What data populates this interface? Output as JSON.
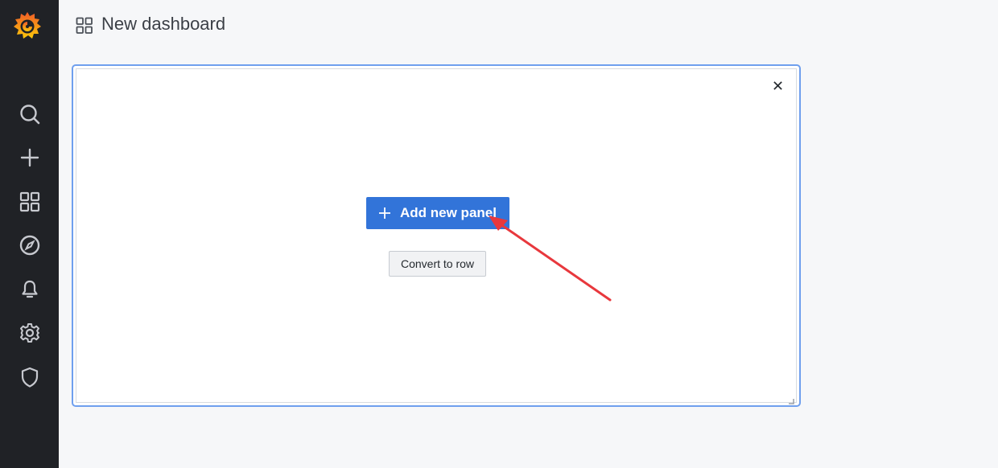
{
  "app": {
    "title": "New dashboard"
  },
  "sidebar": {
    "items": [
      {
        "id": "search",
        "icon": "search-icon"
      },
      {
        "id": "create",
        "icon": "plus-icon"
      },
      {
        "id": "dashboards",
        "icon": "grid-icon"
      },
      {
        "id": "explore",
        "icon": "compass-icon"
      },
      {
        "id": "alerting",
        "icon": "bell-icon"
      },
      {
        "id": "configuration",
        "icon": "gear-icon"
      },
      {
        "id": "server-admin",
        "icon": "shield-icon"
      }
    ]
  },
  "panel": {
    "add_label": "Add new panel",
    "convert_label": "Convert to row"
  },
  "colors": {
    "sidebar_bg": "#202226",
    "primary": "#3274d9",
    "panel_border": "#6f9fee",
    "annotation": "#e8383d",
    "logo_orange": "#f05a28",
    "logo_yellow": "#fbca0a"
  }
}
